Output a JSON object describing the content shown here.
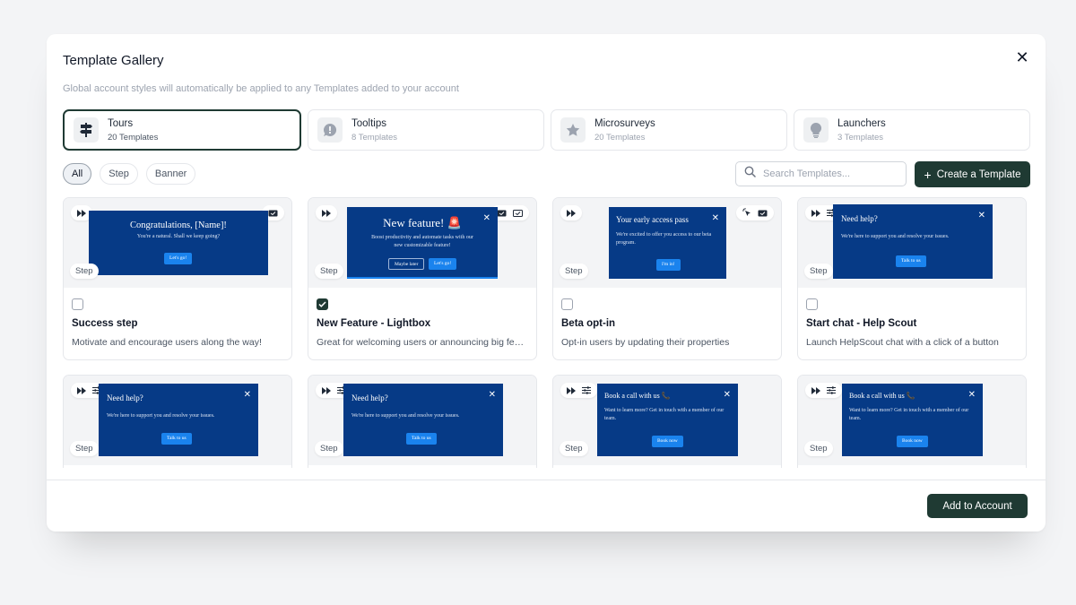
{
  "modal": {
    "title": "Template Gallery",
    "close_icon": "close-icon",
    "subtitle": "Global account styles will automatically be applied to any Templates added to your account"
  },
  "types": [
    {
      "name": "Tours",
      "count": "20 Templates",
      "icon": "signpost-icon",
      "active": true
    },
    {
      "name": "Tooltips",
      "count": "8 Templates",
      "icon": "info-bubble-icon",
      "active": false
    },
    {
      "name": "Microsurveys",
      "count": "20 Templates",
      "icon": "star-icon",
      "active": false
    },
    {
      "name": "Launchers",
      "count": "3 Templates",
      "icon": "lightbulb-icon",
      "active": false
    }
  ],
  "filters": {
    "all": "All",
    "step": "Step",
    "banner": "Banner",
    "active": "All"
  },
  "search": {
    "placeholder": "Search Templates...",
    "value": ""
  },
  "create_button": "Create a Template",
  "step_tag": "Step",
  "cards": [
    {
      "title": "Success step",
      "description": "Motivate and encourage users along the way!",
      "checked": false,
      "preview": {
        "heading": "Congratulations, [Name]!",
        "body": "You're a natural. Shall we keep going?",
        "button": "Let's go!"
      }
    },
    {
      "title": "New Feature - Lightbox",
      "description": "Great for welcoming users or announcing big features",
      "checked": true,
      "preview": {
        "heading": "New feature! 🚨",
        "body": "Boost productivity and automate tasks with our new customizable feature!",
        "button_secondary": "Maybe later",
        "button": "Let's go!"
      }
    },
    {
      "title": "Beta opt-in",
      "description": "Opt-in users by updating their properties",
      "checked": false,
      "preview": {
        "heading": "Your early access pass",
        "body": "We're excited to offer you access to our beta program.",
        "button": "I'm in!"
      }
    },
    {
      "title": "Start chat - Help Scout",
      "description": "Launch HelpScout chat with a click of a button",
      "checked": false,
      "preview": {
        "heading": "Need help?",
        "body": "We're here to support you and resolve your issues.",
        "button": "Talk to us"
      }
    },
    {
      "preview": {
        "heading": "Need help?",
        "body": "We're here to support you and resolve your issues.",
        "button": "Talk to us"
      }
    },
    {
      "preview": {
        "heading": "Need help?",
        "body": "We're here to support you and resolve your issues.",
        "button": "Talk to us"
      }
    },
    {
      "preview": {
        "heading": "Book a call with us 📞",
        "body": "Want to learn more? Get in touch with a member of our team.",
        "button": "Book now"
      }
    },
    {
      "preview": {
        "heading": "Book a call with us 📞",
        "body": "Want to learn more? Get in touch with a member of our team.",
        "button": "Book now"
      }
    }
  ],
  "footer": {
    "add_button": "Add to Account"
  },
  "colors": {
    "primary": "#1f3a33",
    "preview_bg": "#063a86",
    "preview_button": "#1a83ee"
  }
}
